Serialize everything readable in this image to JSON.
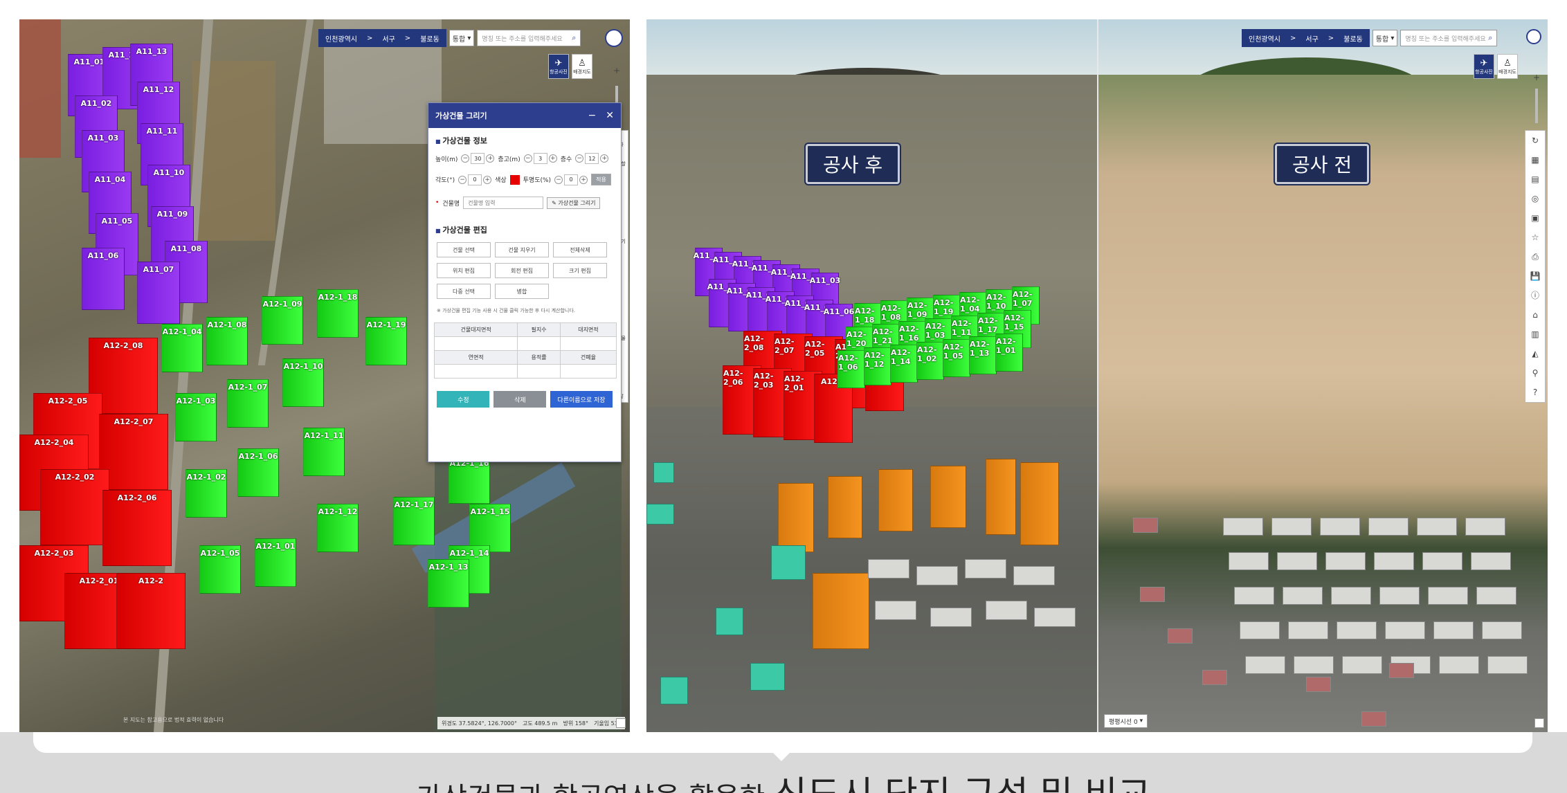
{
  "left_view": {
    "address": [
      "인천광역시",
      "서구",
      "불로동"
    ],
    "address_separator": ">",
    "filter_select": "통합",
    "search_placeholder": "명칭 또는 주소를 입력해주세요",
    "view_buttons": [
      "항공사진",
      "배경지도"
    ],
    "dialog": {
      "title": "가상건물 그리기",
      "section_info": "가상건물 정보",
      "fields": {
        "height_label": "높이(m)",
        "height_value": "30",
        "floor_height_label": "층고(m)",
        "floor_height_value": "3",
        "floors_label": "층수",
        "floors_value": "12",
        "angle_label": "각도(°)",
        "angle_value": "0",
        "color_label": "색상",
        "transparency_label": "투명도(%)",
        "transparency_value": "0",
        "apply_label": "적용"
      },
      "name_label": "건물명",
      "name_placeholder": "건물명 입력",
      "draw_button": "가상건물 그리기",
      "section_edit": "가상건물 편집",
      "edit_buttons": [
        "건물 선택",
        "건물 지우기",
        "전체삭제",
        "위치 편집",
        "회전 편집",
        "크기 편집",
        "다중 선택",
        "병합"
      ],
      "note": "※ 가상건물 편집 기능 사용 시 건물 클릭 가능한 후 다시 계산합니다.",
      "table_headers_1": [
        "건물대지면적",
        "필지수",
        "대지면적"
      ],
      "table_headers_2": [
        "연면적",
        "용적률",
        "건폐율"
      ],
      "footer_buttons": [
        "수정",
        "삭제",
        "다른이름으로 저장"
      ]
    },
    "side_tools": [
      "초기화",
      "화면분할",
      "측정",
      "위치",
      "측정",
      "즐겨찾기",
      "인쇄",
      "저장",
      "정보",
      "교통",
      "가상건물",
      "지형",
      "조회",
      "도움말"
    ],
    "status_bar": {
      "coords": "위경도 37.5824°, 126.7000°",
      "altitude": "고도 489.5 m",
      "heading": "방위 158°",
      "tilt": "기울임 53°"
    },
    "watermark": "본 지도는 참고용으로 법적 효력이 없습니다",
    "buildings_purple": [
      "A11_01",
      "A11_14",
      "A11_13",
      "A11_02",
      "A11_12",
      "A11_03",
      "A11_11",
      "A11_04",
      "A11_10",
      "A11_05",
      "A11_09",
      "A11_08",
      "A11_06",
      "A11_07"
    ],
    "buildings_red": [
      "A12-2_08",
      "A12-2_05",
      "A12-2_04",
      "A12-2_07",
      "A12-2_02",
      "A12-2_06",
      "A12-2_03",
      "A12-2_01",
      "A12-2"
    ],
    "buildings_green": [
      "A12-1_04",
      "A12-1_08",
      "A12-1_09",
      "A12-1_18",
      "A12-1_19",
      "A12-1_07",
      "A12-1_10",
      "A12-1_03",
      "A12-1_11",
      "A12-1_06",
      "A12-1_02",
      "A12-1_16",
      "A12-1_17",
      "A12-1_12",
      "A12-1_05",
      "A12-1_01",
      "A12-1_15",
      "A12-1_14",
      "A12-1_13"
    ]
  },
  "right_view": {
    "after_label": "공사 후",
    "before_label": "공사 전",
    "address": [
      "인천광역시",
      "서구",
      "불로동"
    ],
    "address_separator": ">",
    "filter_select": "통합",
    "search_placeholder": "명칭 또는 주소를 입력해주세요",
    "view_buttons": [
      "항공사진",
      "배경지도"
    ],
    "bottom_select": "평평시선 0",
    "buildings_purple": [
      "A11_14",
      "A11_13",
      "A11_01",
      "A11_12",
      "A11_02",
      "A11_11",
      "A11_03",
      "A11_10",
      "A11_04",
      "A11_09",
      "A11_05",
      "A11_08",
      "A11_07",
      "A11_06"
    ],
    "buildings_red": [
      "A12-2_08",
      "A12-2_07",
      "A12-2_05",
      "A12-2_04",
      "A12-2_02",
      "A12-2_06",
      "A12-2_03",
      "A12-2_01",
      "A12-2"
    ],
    "buildings_green": [
      "A12-1_18",
      "A12-1_08",
      "A12-1_09",
      "A12-1_19",
      "A12-1_04",
      "A12-1_10",
      "A12-1_07",
      "A12-1_20",
      "A12-1_21",
      "A12-1_16",
      "A12-1_03",
      "A12-1_11",
      "A12-1_17",
      "A12-1_15",
      "A12-1_06",
      "A12-1_12",
      "A12-1_14",
      "A12-1_02",
      "A12-1_05",
      "A12-1_13",
      "A12-1_01"
    ]
  },
  "caption": {
    "small": "가상건물과 항공영상을 활용한 ",
    "big": "신도시 단지 구성 및 비교"
  },
  "colors": {
    "purple": "#8a2be2",
    "red": "#ff0000",
    "green": "#22e022",
    "orange": "#f08a1c",
    "nav": "#23377c"
  }
}
